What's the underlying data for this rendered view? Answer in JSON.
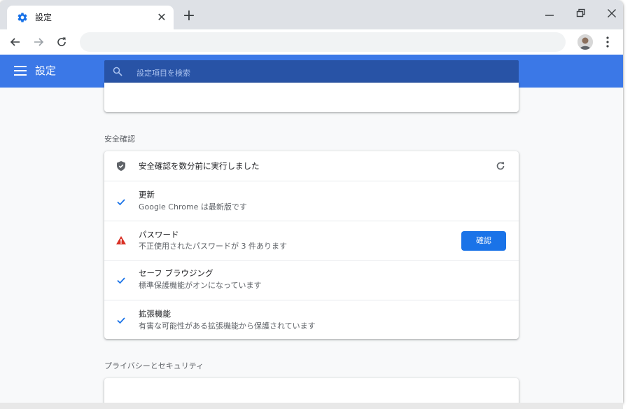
{
  "tab": {
    "title": "設定",
    "close_glyph": "✕",
    "favicon_icon": "gear-icon"
  },
  "tabstrip": {
    "new_tab_glyph": "+"
  },
  "toolbar": {
    "back_icon": "arrow-left-icon",
    "forward_icon": "arrow-right-icon",
    "reload_icon": "reload-icon",
    "menu_icon": "kebab-menu-icon"
  },
  "header": {
    "title": "設定",
    "search_placeholder": "設定項目を検索"
  },
  "sections": {
    "safety_check_title": "安全確認",
    "privacy_title": "プライバシーとセキュリティ"
  },
  "safety_check": {
    "summary": "安全確認を数分前に実行しました",
    "items": [
      {
        "icon": "check-icon",
        "title": "更新",
        "detail": "Google Chrome は最新版です"
      },
      {
        "icon": "warning-icon",
        "title": "パスワード",
        "detail": "不正使用されたパスワードが 3 件あります",
        "button": "確認"
      },
      {
        "icon": "check-icon",
        "title": "セーフ ブラウジング",
        "detail": "標準保護機能がオンになっています"
      },
      {
        "icon": "check-icon",
        "title": "拡張機能",
        "detail": "有害な可能性がある拡張機能から保護されています"
      }
    ]
  },
  "colors": {
    "header_blue": "#3b78e7",
    "search_blue": "#2853a6",
    "check_blue": "#1a73e8",
    "warning_red": "#d93025"
  }
}
